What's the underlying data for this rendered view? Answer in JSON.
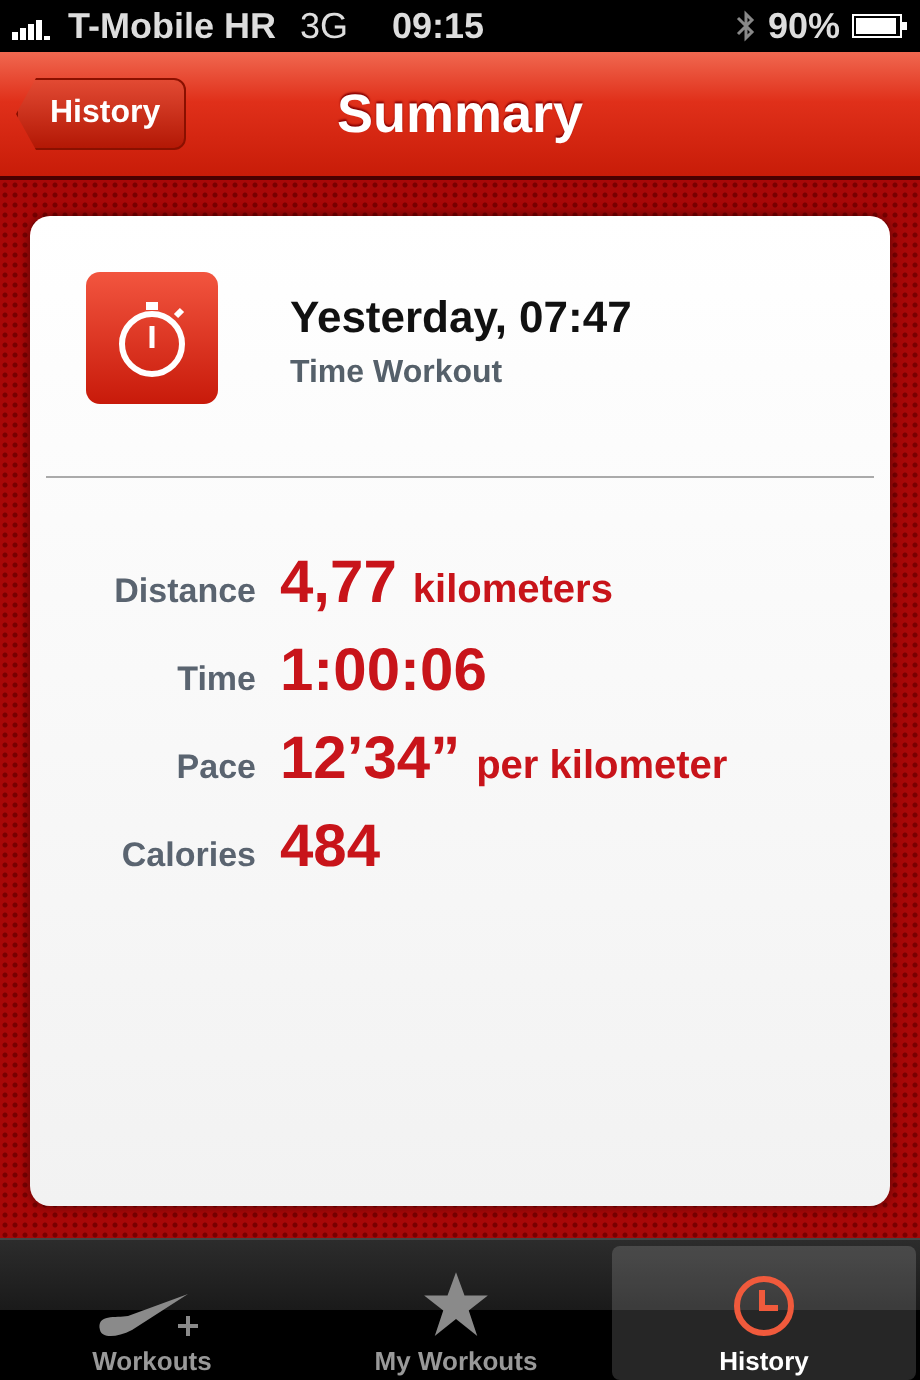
{
  "status_bar": {
    "carrier": "T-Mobile HR",
    "network": "3G",
    "time": "09:15",
    "battery": "90%"
  },
  "nav": {
    "back": "History",
    "title": "Summary"
  },
  "workout": {
    "when": "Yesterday, 07:47",
    "type": "Time Workout"
  },
  "stats": [
    {
      "label": "Distance",
      "value": "4,77",
      "unit": "kilometers"
    },
    {
      "label": "Time",
      "value": "1:00:06"
    },
    {
      "label": "Pace",
      "value": "12’34”",
      "unit": "per kilometer"
    },
    {
      "label": "Calories",
      "value": "484"
    }
  ],
  "tabs": [
    {
      "label": "Workouts",
      "selected": false
    },
    {
      "label": "My Workouts",
      "selected": false
    },
    {
      "label": "History",
      "selected": true
    }
  ]
}
